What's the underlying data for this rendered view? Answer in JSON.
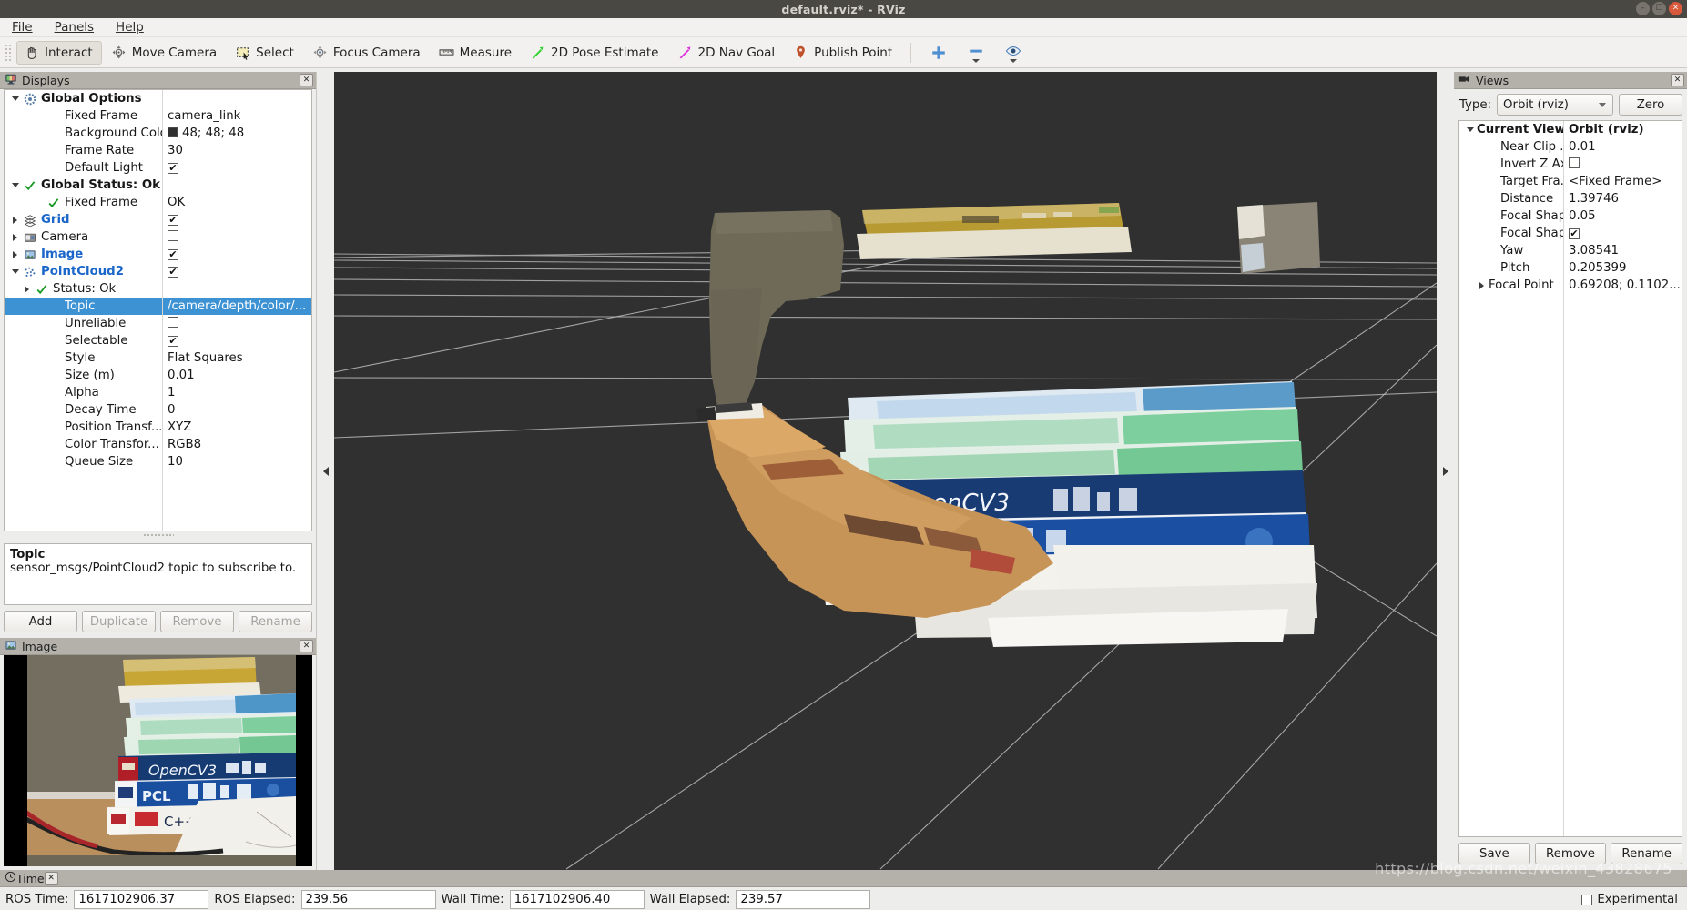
{
  "window": {
    "title": "default.rviz* - RViz",
    "min_glyph": "—",
    "max_glyph": "□",
    "close_glyph": "✕"
  },
  "menubar": {
    "items": [
      {
        "label": "File",
        "mnemonic": "F"
      },
      {
        "label": "Panels",
        "mnemonic": "P"
      },
      {
        "label": "Help",
        "mnemonic": "H"
      }
    ]
  },
  "toolbar": {
    "buttons": [
      {
        "label": "Interact",
        "icon": "hand-cursor-icon",
        "active": true
      },
      {
        "label": "Move Camera",
        "icon": "move-camera-icon",
        "active": false
      },
      {
        "label": "Select",
        "icon": "select-rect-icon",
        "active": false
      },
      {
        "label": "Focus Camera",
        "icon": "focus-camera-icon",
        "active": false
      },
      {
        "label": "Measure",
        "icon": "ruler-icon",
        "active": false
      },
      {
        "label": "2D Pose Estimate",
        "icon": "green-arrow-icon",
        "active": false
      },
      {
        "label": "2D Nav Goal",
        "icon": "magenta-arrow-icon",
        "active": false
      },
      {
        "label": "Publish Point",
        "icon": "map-pin-icon",
        "active": false
      }
    ],
    "extras": [
      {
        "icon": "plus-icon",
        "label": ""
      },
      {
        "icon": "minus-icon",
        "label": ""
      },
      {
        "icon": "eye-icon",
        "label": ""
      }
    ]
  },
  "displays": {
    "panel_title": "Displays",
    "panel_icon": "displays-monitor-icon",
    "close_label": "✕",
    "rows": [
      {
        "indent": 0,
        "expander": "down",
        "icon": "gear-icon",
        "label": "Global Options",
        "style": "bold_black",
        "value": "",
        "value_type": "none"
      },
      {
        "indent": 2,
        "expander": "none",
        "icon": "none",
        "label": "Fixed Frame",
        "style": "plain",
        "value": "camera_link",
        "value_type": "text"
      },
      {
        "indent": 2,
        "expander": "none",
        "icon": "none",
        "label": "Background Color",
        "style": "plain",
        "value": "48; 48; 48",
        "value_type": "color",
        "color": "#303030"
      },
      {
        "indent": 2,
        "expander": "none",
        "icon": "none",
        "label": "Frame Rate",
        "style": "plain",
        "value": "30",
        "value_type": "text"
      },
      {
        "indent": 2,
        "expander": "none",
        "icon": "none",
        "label": "Default Light",
        "style": "plain",
        "value": "",
        "value_type": "checked"
      },
      {
        "indent": 0,
        "expander": "down",
        "icon": "check-green-icon",
        "label": "Global Status: Ok",
        "style": "bold_black",
        "value": "",
        "value_type": "none"
      },
      {
        "indent": 2,
        "expander": "none",
        "icon": "check-green-icon",
        "label": "Fixed Frame",
        "style": "plain",
        "value": "OK",
        "value_type": "text"
      },
      {
        "indent": 0,
        "expander": "right",
        "icon": "grid-icon",
        "label": "Grid",
        "style": "blue_bold",
        "value": "",
        "value_type": "checked"
      },
      {
        "indent": 0,
        "expander": "right",
        "icon": "camera-icon",
        "label": "Camera",
        "style": "plain",
        "value": "",
        "value_type": "unchecked"
      },
      {
        "indent": 0,
        "expander": "right",
        "icon": "image-icon",
        "label": "Image",
        "style": "blue_bold",
        "value": "",
        "value_type": "checked"
      },
      {
        "indent": 0,
        "expander": "down",
        "icon": "pointcloud-icon",
        "label": "PointCloud2",
        "style": "blue_bold",
        "value": "",
        "value_type": "checked"
      },
      {
        "indent": 1,
        "expander": "right",
        "icon": "check-green-icon",
        "label": "Status: Ok",
        "style": "plain",
        "value": "",
        "value_type": "none"
      },
      {
        "indent": 2,
        "expander": "none",
        "icon": "none",
        "label": "Topic",
        "style": "plain",
        "value": "/camera/depth/color/...",
        "value_type": "text",
        "selected": true
      },
      {
        "indent": 2,
        "expander": "none",
        "icon": "none",
        "label": "Unreliable",
        "style": "plain",
        "value": "",
        "value_type": "unchecked"
      },
      {
        "indent": 2,
        "expander": "none",
        "icon": "none",
        "label": "Selectable",
        "style": "plain",
        "value": "",
        "value_type": "checked"
      },
      {
        "indent": 2,
        "expander": "none",
        "icon": "none",
        "label": "Style",
        "style": "plain",
        "value": "Flat Squares",
        "value_type": "text"
      },
      {
        "indent": 2,
        "expander": "none",
        "icon": "none",
        "label": "Size (m)",
        "style": "plain",
        "value": "0.01",
        "value_type": "text"
      },
      {
        "indent": 2,
        "expander": "none",
        "icon": "none",
        "label": "Alpha",
        "style": "plain",
        "value": "1",
        "value_type": "text"
      },
      {
        "indent": 2,
        "expander": "none",
        "icon": "none",
        "label": "Decay Time",
        "style": "plain",
        "value": "0",
        "value_type": "text"
      },
      {
        "indent": 2,
        "expander": "none",
        "icon": "none",
        "label": "Position Transf...",
        "style": "plain",
        "value": "XYZ",
        "value_type": "text"
      },
      {
        "indent": 2,
        "expander": "none",
        "icon": "none",
        "label": "Color Transfor...",
        "style": "plain",
        "value": "RGB8",
        "value_type": "text"
      },
      {
        "indent": 2,
        "expander": "none",
        "icon": "none",
        "label": "Queue Size",
        "style": "plain",
        "value": "10",
        "value_type": "text"
      }
    ],
    "description": {
      "title": "Topic",
      "body": "sensor_msgs/PointCloud2 topic to subscribe to."
    },
    "buttons": [
      {
        "label": "Add",
        "enabled": true
      },
      {
        "label": "Duplicate",
        "enabled": false
      },
      {
        "label": "Remove",
        "enabled": false
      },
      {
        "label": "Rename",
        "enabled": false
      }
    ]
  },
  "image_panel": {
    "panel_title": "Image",
    "panel_icon": "image-icon",
    "close_label": "✕"
  },
  "views": {
    "panel_title": "Views",
    "panel_icon": "views-camera-icon",
    "close_label": "✕",
    "type_label": "Type:",
    "type_value": "Orbit (rviz)",
    "zero_label": "Zero",
    "rows": [
      {
        "indent": 0,
        "expander": "down",
        "label": "Current View",
        "style": "bold",
        "value": "Orbit (rviz)",
        "value_style": "bold",
        "value_type": "text"
      },
      {
        "indent": 2,
        "expander": "none",
        "label": "Near Clip ...",
        "style": "plain",
        "value": "0.01",
        "value_type": "text"
      },
      {
        "indent": 2,
        "expander": "none",
        "label": "Invert Z Axis",
        "style": "plain",
        "value": "",
        "value_type": "unchecked"
      },
      {
        "indent": 2,
        "expander": "none",
        "label": "Target Fra...",
        "style": "plain",
        "value": "<Fixed Frame>",
        "value_type": "text"
      },
      {
        "indent": 2,
        "expander": "none",
        "label": "Distance",
        "style": "plain",
        "value": "1.39746",
        "value_type": "text"
      },
      {
        "indent": 2,
        "expander": "none",
        "label": "Focal Shap...",
        "style": "plain",
        "value": "0.05",
        "value_type": "text"
      },
      {
        "indent": 2,
        "expander": "none",
        "label": "Focal Shap...",
        "style": "plain",
        "value": "",
        "value_type": "checked"
      },
      {
        "indent": 2,
        "expander": "none",
        "label": "Yaw",
        "style": "plain",
        "value": "3.08541",
        "value_type": "text"
      },
      {
        "indent": 2,
        "expander": "none",
        "label": "Pitch",
        "style": "plain",
        "value": "0.205399",
        "value_type": "text"
      },
      {
        "indent": 1,
        "expander": "right",
        "label": "Focal Point",
        "style": "plain",
        "value": "0.69208; 0.1102...",
        "value_type": "text"
      }
    ],
    "buttons": [
      {
        "label": "Save"
      },
      {
        "label": "Remove"
      },
      {
        "label": "Rename"
      }
    ]
  },
  "time_panel": {
    "panel_title": "Time",
    "panel_icon": "clock-icon",
    "close_label": "✕",
    "fields": [
      {
        "label": "ROS Time:",
        "value": "1617102906.37"
      },
      {
        "label": "ROS Elapsed:",
        "value": "239.56"
      },
      {
        "label": "Wall Time:",
        "value": "1617102906.40"
      },
      {
        "label": "Wall Elapsed:",
        "value": "239.57"
      }
    ],
    "experimental_label": "Experimental"
  },
  "viewport": {
    "background_color": "#303030",
    "grid_color": "#b0b0b0",
    "scene_description": "Colored point cloud of a stack of books on a desk beside a wall"
  },
  "watermark": "https://blog.csdn.net/weixin_43828675"
}
